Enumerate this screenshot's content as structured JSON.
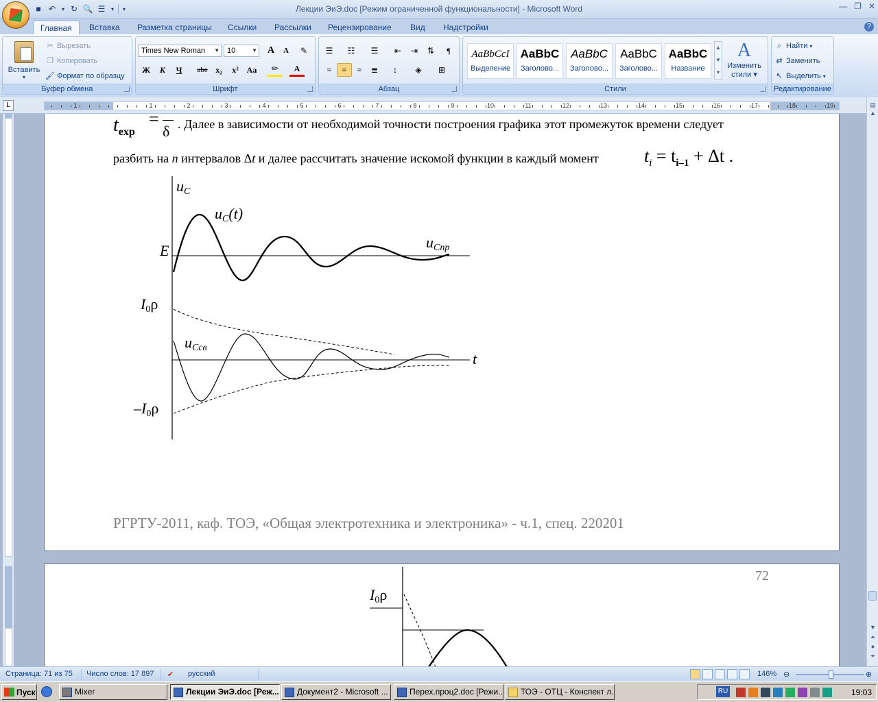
{
  "window": {
    "title": "Лекции ЭиЭ.doc [Режим ограниченной функциональности] - Microsoft Word"
  },
  "ribbon": {
    "tabs": [
      {
        "label": "Главная"
      },
      {
        "label": "Вставка"
      },
      {
        "label": "Разметка страницы"
      },
      {
        "label": "Ссылки"
      },
      {
        "label": "Рассылки"
      },
      {
        "label": "Рецензирование"
      },
      {
        "label": "Вид"
      },
      {
        "label": "Надстройки"
      }
    ],
    "clipboard": {
      "title": "Буфер обмена",
      "paste": "Вставить",
      "cut": "Вырезать",
      "copy": "Копировать",
      "format_painter": "Формат по образцу"
    },
    "font": {
      "title": "Шрифт",
      "font_name": "Times New Roman",
      "font_size": "10",
      "grow": "A",
      "shrink": "A",
      "bold": "Ж",
      "italic": "К",
      "underline": "Ч",
      "strike": "abe",
      "subscript": "x₂",
      "superscript": "x²",
      "case": "Aa"
    },
    "paragraph": {
      "title": "Абзац"
    },
    "styles": {
      "title": "Стили",
      "items": [
        {
          "sample": "AaBbCcI",
          "label": "Выделение"
        },
        {
          "sample": "AaBbC",
          "label": "Заголово..."
        },
        {
          "sample": "AaBbC",
          "label": "Заголово..."
        },
        {
          "sample": "AaBbC",
          "label": "Заголово..."
        },
        {
          "sample": "AaBbC",
          "label": "Название"
        }
      ],
      "change_line1": "Изменить",
      "change_line2": "стили"
    },
    "editing": {
      "title": "Редактирование",
      "find": "Найти",
      "replace": "Заменить",
      "select": "Выделить"
    }
  },
  "ruler": {
    "numbers": [
      "1",
      "1",
      "2",
      "3",
      "4",
      "5",
      "6",
      "7",
      "8",
      "9",
      "10",
      "11",
      "12",
      "13",
      "14",
      "15",
      "16",
      "17",
      "18",
      "19"
    ]
  },
  "document": {
    "line1_formula_left": "t",
    "line1_formula_sub": "exp",
    "line1_formula_rest": "=",
    "line1_frac_den": "δ",
    "line1_text": ". Далее в зависимости от необходимой точности построения графика этот промежуток времени следует",
    "line2_text_a": "разбить на",
    "line2_n": "n",
    "line2_text_b": "интервалов Δ",
    "line2_t": "t",
    "line2_text_c": "и далее рассчитать значение искомой функции в каждый момент",
    "line2_formula": "t",
    "line2_formula_sub_i": "i",
    "line2_formula_eq": "= t",
    "line2_formula_sub_prev": "i–1",
    "line2_formula_tail": "+ Δt .",
    "figure1": {
      "axis_u": "u",
      "axis_u_sub": "C",
      "curve_label": "u",
      "curve_label_sub": "C",
      "curve_label_arg": "(t)",
      "E_label": "E",
      "ucpr_label": "u",
      "ucpr_sub": "Cпр",
      "I0p_label": "I",
      "I0p_sub": "0",
      "I0p_rho": "ρ",
      "ucsv_label": "u",
      "ucsv_sub": "Cсв",
      "t_label": "t",
      "minus_I0p_label": "–I",
      "minus_I0p_sub": "0",
      "minus_I0p_rho": "ρ"
    },
    "footer": "РГРТУ-2011, каф. ТОЭ, «Общая электротехника и электроника» - ч.1, спец. 220201",
    "page2_number": "72",
    "figure2": {
      "I0p_label": "I",
      "I0p_sub": "0",
      "I0p_rho": "ρ"
    }
  },
  "status": {
    "page": "Страница: 71 из 75",
    "words": "Число слов: 17 897",
    "language": "русский",
    "zoom": "146%"
  },
  "taskbar": {
    "start": "Пуск",
    "tasks": [
      {
        "label": "Mixer"
      },
      {
        "label": "Лекции ЭиЭ.doc [Реж..."
      },
      {
        "label": "Документ2 - Microsoft ..."
      },
      {
        "label": "Перех.проц2.doc [Режи..."
      },
      {
        "label": "ТОЭ - ОТЦ - Конспект л..."
      }
    ],
    "lang": "RU",
    "clock": "19:03"
  }
}
